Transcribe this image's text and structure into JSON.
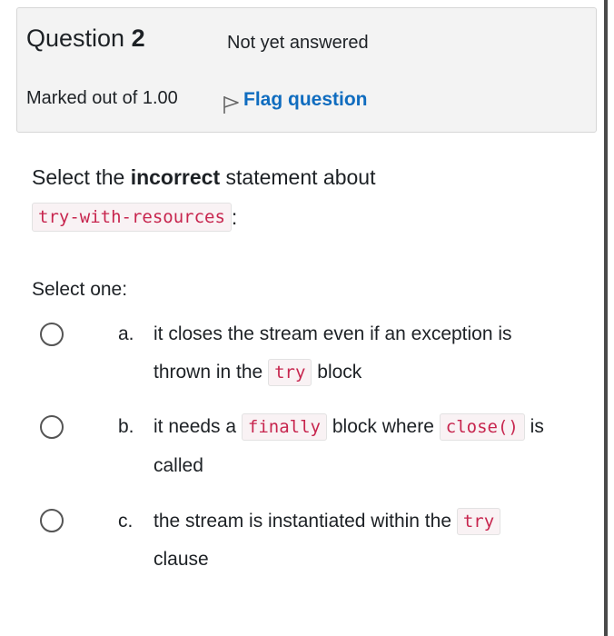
{
  "info": {
    "question_word": "Question",
    "question_number": "2",
    "state": "Not yet answered",
    "grade": "Marked out of 1.00",
    "flag_label": "Flag question"
  },
  "qtext": {
    "prefix": "Select the",
    "emphasis": "incorrect",
    "suffix": "statement about",
    "code": "try-with-resources",
    "end": ":"
  },
  "prompt": "Select one:",
  "options": [
    {
      "letter": "a.",
      "line1": "it closes the stream even if an exception is",
      "line2_pre": "thrown in the",
      "line2_code": "try",
      "line2_post": "block"
    },
    {
      "letter": "b.",
      "line1_pre": "it needs a",
      "line1_code1": "finally",
      "line1_mid": "block where",
      "line1_code2": "close()",
      "line1_post": "is",
      "line2": "called"
    },
    {
      "letter": "c.",
      "line1_pre": "the stream is instantiated within the",
      "line1_code": "try",
      "line2": "clause"
    }
  ],
  "icons": {
    "flag": "flag-icon",
    "radio": "radio-unchecked-icon"
  },
  "colors": {
    "link": "#0f6cbf",
    "code_text": "#c7254e",
    "code_bg": "#f9f2f4",
    "info_bg": "#f3f3f3"
  }
}
